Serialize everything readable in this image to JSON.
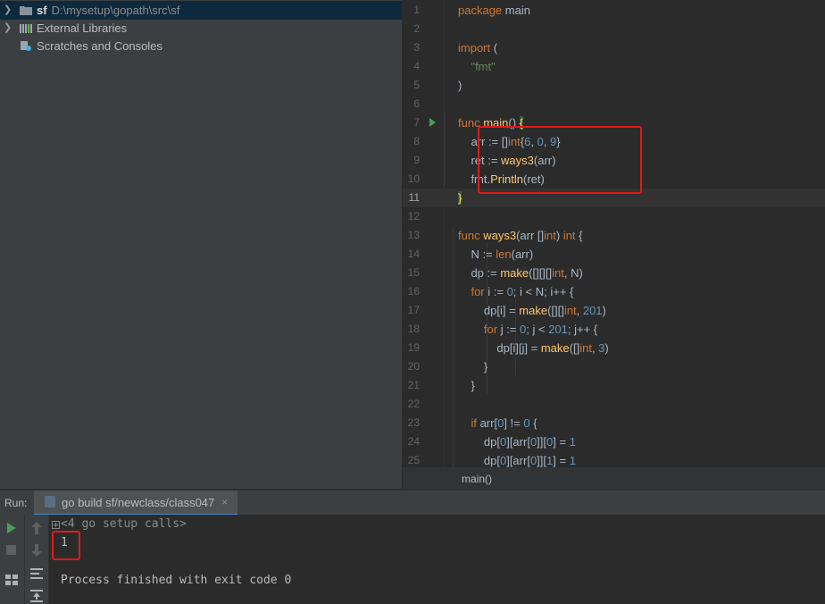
{
  "project_tree": {
    "root": {
      "name": "sf",
      "path": "D:\\mysetup\\gopath\\src\\sf"
    },
    "external_libraries": "External Libraries",
    "scratches": "Scratches and Consoles"
  },
  "editor": {
    "lines": [
      {
        "n": "1"
      },
      {
        "n": "2"
      },
      {
        "n": "3"
      },
      {
        "n": "4"
      },
      {
        "n": "5"
      },
      {
        "n": "6"
      },
      {
        "n": "7"
      },
      {
        "n": "8"
      },
      {
        "n": "9"
      },
      {
        "n": "10"
      },
      {
        "n": "11"
      },
      {
        "n": "12"
      },
      {
        "n": "13"
      },
      {
        "n": "14"
      },
      {
        "n": "15"
      },
      {
        "n": "16"
      },
      {
        "n": "17"
      },
      {
        "n": "18"
      },
      {
        "n": "19"
      },
      {
        "n": "20"
      },
      {
        "n": "21"
      },
      {
        "n": "22"
      },
      {
        "n": "23"
      },
      {
        "n": "24"
      },
      {
        "n": "25"
      }
    ],
    "breadcrumb": "main()"
  },
  "run_panel": {
    "label": "Run:",
    "tab_label": "go build sf/newclass/class047",
    "close_glyph": "×",
    "console": {
      "setup_calls": "<4 go setup calls>",
      "output": "1",
      "finished": "Process finished with exit code 0"
    }
  },
  "colors": {
    "highlight_box": "#e0191b",
    "keyword": "#cc7832",
    "function": "#ffc66d",
    "string": "#6a8759",
    "number": "#6897bb"
  }
}
